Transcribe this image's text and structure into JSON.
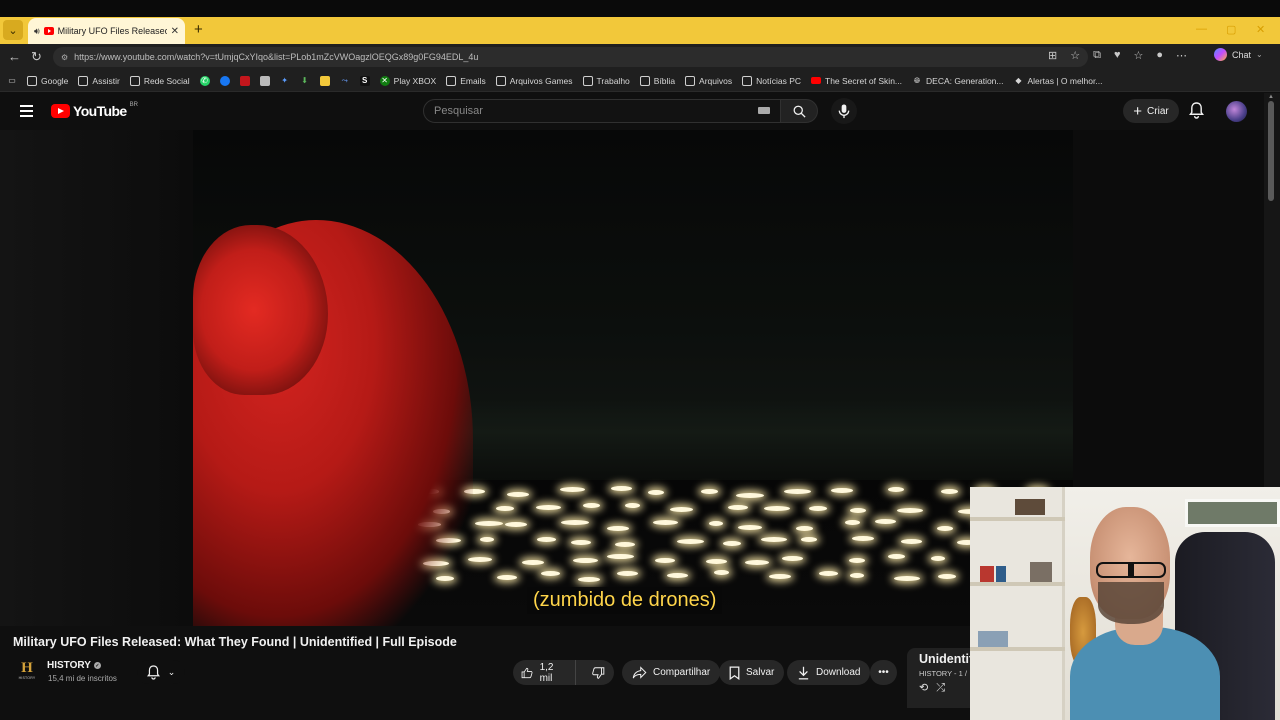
{
  "browser": {
    "tab_title": "Military UFO Files Released: W",
    "url": "https://www.youtube.com/watch?v=tUmjqCxYIqo&list=PLob1mZcVWOagzlOEQGx89g0FG94EDL_4u",
    "chat_label": "Chat",
    "accent_color": "#f2c83a",
    "bookmarks": [
      {
        "label": "Google",
        "icon": "folder-icon"
      },
      {
        "label": "Assistir",
        "icon": "folder-icon"
      },
      {
        "label": "Rede Social",
        "icon": "folder-icon"
      },
      {
        "label": "Play XBOX",
        "icon": "xbox-icon"
      },
      {
        "label": "Emails",
        "icon": "folder-icon"
      },
      {
        "label": "Arquivos Games",
        "icon": "folder-icon"
      },
      {
        "label": "Trabalho",
        "icon": "folder-icon"
      },
      {
        "label": "Bíblia",
        "icon": "folder-icon"
      },
      {
        "label": "Arquivos",
        "icon": "folder-icon"
      },
      {
        "label": "Notícias PC",
        "icon": "folder-icon"
      },
      {
        "label": "The Secret of Skin...",
        "icon": "youtube-icon"
      },
      {
        "label": "DECA: Generation...",
        "icon": "globe-icon"
      },
      {
        "label": "Alertas | O melhor...",
        "icon": "bookmark-icon"
      }
    ]
  },
  "youtube": {
    "logo_text": "YouTube",
    "country_code": "BR",
    "search_placeholder": "Pesquisar",
    "create_label": "Criar"
  },
  "video": {
    "caption": "(zumbido de drones)",
    "title": "Military UFO Files Released: What They Found | Unidentified | Full Episode",
    "channel_name": "HISTORY",
    "channel_logo_letter": "H",
    "channel_logo_sub": "HISTORY",
    "subscribers": "15,4 mi de inscritos",
    "likes": "1,2 mil",
    "share_label": "Compartilhar",
    "save_label": "Salvar",
    "download_label": "Download"
  },
  "playlist": {
    "title": "Unidentified",
    "channel_count": "HISTORY - 1 /"
  }
}
